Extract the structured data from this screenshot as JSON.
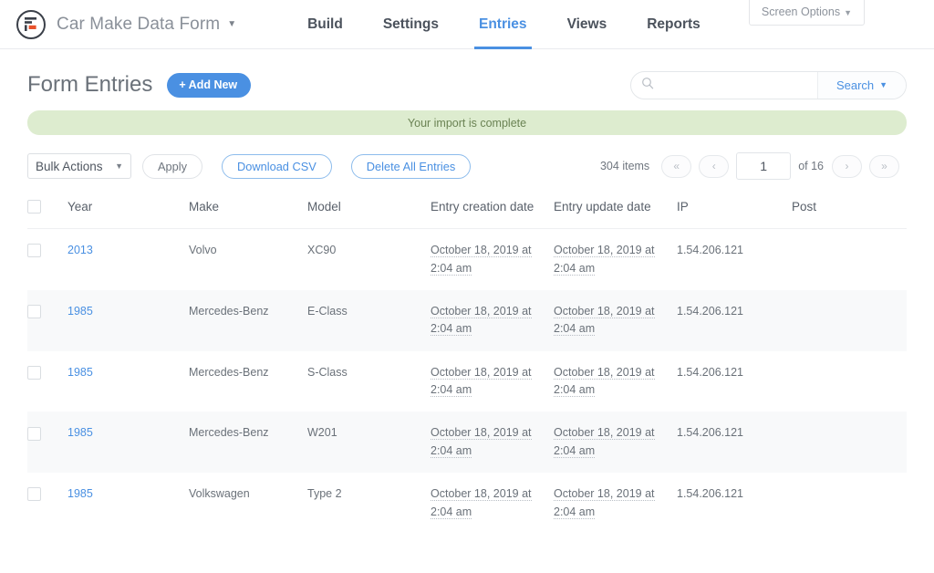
{
  "topbar": {
    "logo_icon": "formidable-forms-logo-icon",
    "brand_title": "Car Make Data Form",
    "brand_caret": "▼",
    "nav": [
      {
        "label": "Build",
        "active": false
      },
      {
        "label": "Settings",
        "active": false
      },
      {
        "label": "Entries",
        "active": true
      },
      {
        "label": "Views",
        "active": false
      },
      {
        "label": "Reports",
        "active": false
      }
    ],
    "screen_options": {
      "label": "Screen Options",
      "caret": "▼"
    }
  },
  "page": {
    "title": "Form Entries",
    "add_new": {
      "plus": "+",
      "label": "Add New"
    },
    "search": {
      "icon": "search-icon",
      "value": "",
      "placeholder": "",
      "dropdown_label": "Search",
      "dropdown_caret": "▼"
    },
    "notice": {
      "text": "Your import is complete",
      "color": "#ddeccf"
    }
  },
  "toolbar": {
    "bulk_actions": {
      "label": "Bulk Actions",
      "caret": "▼"
    },
    "apply_label": "Apply",
    "download_csv_label": "Download CSV",
    "delete_all_label": "Delete All Entries",
    "pager": {
      "items_text": "304 items",
      "first_label": "«",
      "prev_label": "‹",
      "current_page": "1",
      "of_total": "of 16",
      "next_label": "›",
      "last_label": "»"
    }
  },
  "table": {
    "headers": [
      "Year",
      "Make",
      "Model",
      "Entry creation date",
      "Entry update date",
      "IP",
      "Post"
    ],
    "rows": [
      {
        "year": "2013",
        "make": "Volvo",
        "model": "XC90",
        "created": "October 18, 2019 at 2:04 am",
        "updated": "October 18, 2019 at 2:04 am",
        "ip": "1.54.206.121",
        "post": ""
      },
      {
        "year": "1985",
        "make": "Mercedes-Benz",
        "model": "E-Class",
        "created": "October 18, 2019 at 2:04 am",
        "updated": "October 18, 2019 at 2:04 am",
        "ip": "1.54.206.121",
        "post": ""
      },
      {
        "year": "1985",
        "make": "Mercedes-Benz",
        "model": "S-Class",
        "created": "October 18, 2019 at 2:04 am",
        "updated": "October 18, 2019 at 2:04 am",
        "ip": "1.54.206.121",
        "post": ""
      },
      {
        "year": "1985",
        "make": "Mercedes-Benz",
        "model": "W201",
        "created": "October 18, 2019 at 2:04 am",
        "updated": "October 18, 2019 at 2:04 am",
        "ip": "1.54.206.121",
        "post": ""
      },
      {
        "year": "1985",
        "make": "Volkswagen",
        "model": "Type 2",
        "created": "October 18, 2019 at 2:04 am",
        "updated": "October 18, 2019 at 2:04 am",
        "ip": "1.54.206.121",
        "post": ""
      }
    ]
  },
  "theme": {
    "accent": "#4a90e2",
    "text": "#6a7179",
    "notice_bg": "#ddeccf",
    "notice_text": "#6b8354",
    "stripe": "#f8f9fa",
    "logo_accent": "#e8522c"
  }
}
